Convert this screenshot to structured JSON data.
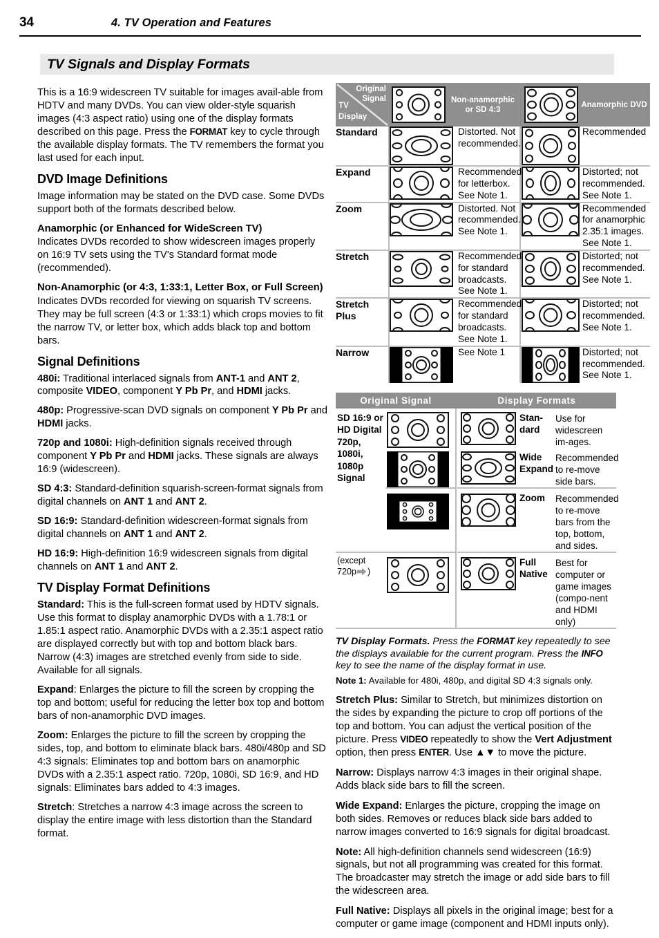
{
  "runhead": {
    "page_number": "34",
    "chapter_title": "4.  TV Operation and Features"
  },
  "section": {
    "banner_title": "TV Signals and Display Formats"
  },
  "left_column": {
    "intro": "This is a 16:9 widescreen TV suitable for images available from HDTV and many DVDs.  You can view older-style squarish images (4:3 aspect ratio) using one of the display formats described on this page.  Press the FORMAT key to cycle through the available display formats. The TV remembers the format you last used for each input.",
    "intro_key": "FORMAT",
    "intro_a": "This is a 16:9 widescreen TV suitable for images avail-able from HDTV and many DVDs.  You can view older-style squarish images (4:3 aspect ratio) using one of the display formats described on this page.  Press the ",
    "intro_b": " key to cycle through the available display formats. The TV remembers the format you last used for each input.",
    "dvd_heading": "DVD Image Definitions",
    "dvd_intro": "Image information may be stated on the DVD case.  Some DVDs support both of the formats described below.",
    "anamorphic_heading": "Anamorphic (or Enhanced for WideScreen TV)",
    "anamorphic_body": "Indicates DVDs recorded to show widescreen images properly on 16:9 TV sets using the TV’s Standard format mode (recommended).",
    "nonanamorphic_heading": "Non-Anamorphic (or 4:3, 1:33:1, Letter Box, or Full Screen)",
    "nonanamorphic_body": "Indicates DVDs recorded for viewing on squarish TV screens.  They may be full screen (4:3 or 1:33:1) which crops movies to fit the narrow TV, or letter box, which adds black top and bottom bars.",
    "signal_heading": "Signal Definitions",
    "signals": [
      {
        "term": "480i:",
        "body": " Traditional interlaced signals from <b>ANT-1</b> and <b>ANT 2</b>, composite <b>VIDEO</b>, component <b>Y Pb Pr</b>, and <b>HDMI</b> jacks."
      },
      {
        "term": "480p:",
        "body": " Progressive-scan DVD signals on component <b>Y Pb Pr</b> and <b>HDMI</b> jacks."
      },
      {
        "term": "720p and 1080i:",
        "body": " High-definition signals received through component <b>Y Pb Pr</b> and <b>HDMI</b> jacks.  These signals are always 16:9 (widescreen)."
      },
      {
        "term": "SD 4:3:",
        "body": " Standard-definition squarish-screen-format signals from digital channels on <b>ANT 1</b> and <b>ANT 2</b>."
      },
      {
        "term": "SD 16:9:",
        "body": " Standard-definition widescreen-format signals from digital channels on <b>ANT 1</b> and <b>ANT 2</b>."
      },
      {
        "term": "HD 16:9:",
        "body": " High-definition 16:9 widescreen signals from digital channels on <b>ANT 1</b> and <b>ANT 2</b>."
      }
    ],
    "tvformat_heading": "TV Display Format Definitions",
    "formats": [
      {
        "term": "Standard:",
        "body": "  This is the full-screen format used by HDTV signals.  Use this format to display anamorphic DVDs with a 1.78:1 or 1.85:1 aspect ratio.  Anamorphic DVDs with a 2.35:1 aspect ratio are displayed correctly but with top and bottom black bars.  Narrow (4:3) images are stretched evenly from side to side.  Available for all signals."
      },
      {
        "term": "Expand",
        "body": ":  Enlarges the picture to fill the screen by cropping the top and bottom; useful for reducing the letter box top and bottom bars of non-anamorphic DVD images."
      },
      {
        "term": "Zoom:",
        "body": "  Enlarges the picture to fill the screen by cropping the sides, top, and bottom to eliminate black bars.  480i/480p and SD 4:3 signals:  Eliminates top and bottom bars on anamorphic DVDs with a 2.35:1 aspect ratio.  720p, 1080i, SD 16:9, and HD signals:  Eliminates bars added to 4:3 images."
      },
      {
        "term": "Stretch",
        "body": ":  Stretches a narrow 4:3 image across the screen to display the entire image with less distortion than the Standard format."
      }
    ]
  },
  "table1": {
    "corner": {
      "original": "Original",
      "signal": "Signal",
      "tv": "TV",
      "display": "Display"
    },
    "col_headers": [
      "Non-anamorphic or SD 4:3",
      "Anamorphic DVD"
    ],
    "rows": [
      {
        "label": "Standard",
        "left_desc": "Distorted.  Not recommended.",
        "right_desc": "Recommended"
      },
      {
        "label": "Expand",
        "left_desc": "Recommended for letterbox. See Note 1.",
        "right_desc": "Distorted; not recommended. See Note 1."
      },
      {
        "label": "Zoom",
        "left_desc": "Distorted.  Not recommended. See Note 1.",
        "right_desc": "Recommended for anamorphic 2.35:1 images. See Note 1."
      },
      {
        "label": "Stretch",
        "left_desc": "Recommended for standard broadcasts. See Note 1.",
        "right_desc": "Distorted; not recommended. See Note 1."
      },
      {
        "label": "Stretch Plus",
        "left_desc": "Recommended for standard broadcasts. See Note 1.",
        "right_desc": "Distorted; not recommended. See Note 1."
      },
      {
        "label": "Narrow",
        "left_desc": "See Note 1",
        "right_desc": "Distorted; not recommended. See Note 1."
      }
    ]
  },
  "table2": {
    "header_left": "Original Signal",
    "header_right": "Display Formats",
    "signal_label": "SD 16:9 or HD Digital 720p, 1080i, 1080p Signal",
    "except_label": "(except 720p",
    "except_tail": ")",
    "rows": [
      {
        "format": "Stan-dard",
        "desc": "Use for widescreen im-ages."
      },
      {
        "format": "Wide Expand",
        "desc": "Recommended to re-move side bars."
      },
      {
        "format": "Zoom",
        "desc": "Recommended to re-move bars from the top, bottom, and sides."
      },
      {
        "format": "Full Native",
        "desc": "Best for computer or game images (compo-nent and HDMI only)"
      }
    ]
  },
  "right_column": {
    "caption_lead": "TV Display Formats.",
    "caption_body_a": "  Press the ",
    "caption_key1": "FORMAT",
    "caption_body_b": " key repeatedly to see the displays available for the current program.  Press the ",
    "caption_key2": "INFO",
    "caption_body_c": " key to see the name of the display format in use.",
    "note1_term": "Note 1:",
    "note1_body": "  Available for 480i, 480p, and digital SD 4:3 signals only.",
    "paras": [
      {
        "term": "Stretch Plus:",
        "body": "  Similar to Stretch, but minimizes distortion on the sides by expanding the picture to crop off portions of the top and bottom.  You can adjust the vertical position of the picture.  Press <span class=\"mono\">VIDEO</span> repeatedly to show the <b>Vert Adjustment</b> option, then press <span class=\"mono\">ENTER</span>.  Use ▲▼ to move the picture."
      },
      {
        "term": "Narrow:",
        "body": "  Displays narrow 4:3 images in their original shape.  Adds black side bars to fill the screen."
      },
      {
        "term": "Wide Expand:",
        "body": "  Enlarges the picture, cropping the image on both sides.  Removes or reduces black side bars added to narrow images converted to 16:9 signals for digital broadcast."
      },
      {
        "term": "Note:",
        "body": "  All high-definition channels send widescreen (16:9) signals, but not all programming was created for this format.  The broadcaster may stretch the image or add side bars to fill the widescreen area."
      },
      {
        "term": "Full Native:",
        "body": "  Displays all pixels in the original image; best for a computer or game image (component and HDMI inputs only)."
      }
    ]
  },
  "colors": {
    "header_gray": "#8f8f8f",
    "banner_gray": "#e8e8e8",
    "rule_gray": "#bdbdbd",
    "black": "#000000"
  }
}
